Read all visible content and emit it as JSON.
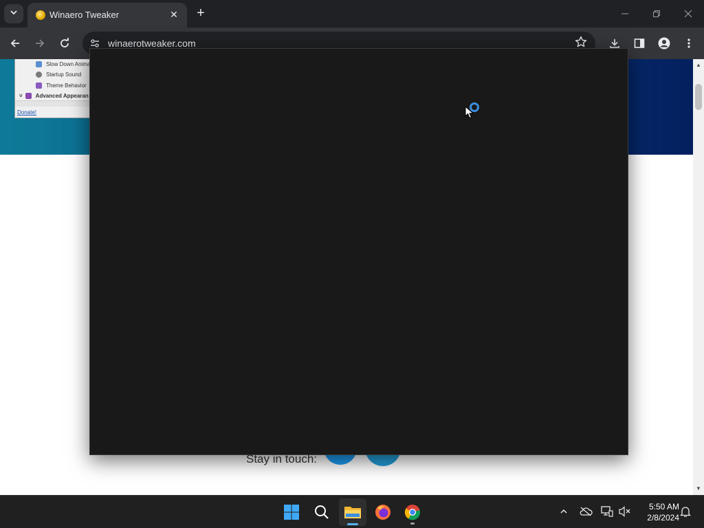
{
  "browser": {
    "tab": {
      "title": "Winaero Tweaker",
      "close_glyph": "✕"
    },
    "new_tab_glyph": "+",
    "window_controls": {
      "minimize": "─",
      "restore": "❐",
      "close": "✕"
    },
    "address_bar": {
      "url": "winaerotweaker.com"
    }
  },
  "page": {
    "app_screenshot": {
      "items": [
        {
          "label": "Slow Down Animati",
          "icon_color": "#5a8fd0"
        },
        {
          "label": "Startup Sound",
          "icon_color": "#7a7a7a"
        },
        {
          "label": "Theme Behavior",
          "icon_color": "#8a5ac0"
        },
        {
          "label": "Advanced Appearan",
          "icon_color": "#8a4ab0"
        }
      ],
      "donate_label": "Donate!"
    },
    "stay_in_touch": "Stay in touch:",
    "social_colors": {
      "twitter": "#1d9bf0",
      "telegram": "#229ed9",
      "youtube": "#e62117"
    }
  },
  "overlay": {
    "background": "#191919",
    "spinner_color": "#3a8fe0"
  },
  "taskbar": {
    "apps": [
      {
        "name": "start",
        "active": false
      },
      {
        "name": "search",
        "active": false
      },
      {
        "name": "file-explorer",
        "active": true
      },
      {
        "name": "firefox",
        "active": false
      },
      {
        "name": "chrome",
        "active": false
      }
    ],
    "clock": {
      "time": "5:50 AM",
      "date": "2/8/2024"
    }
  }
}
